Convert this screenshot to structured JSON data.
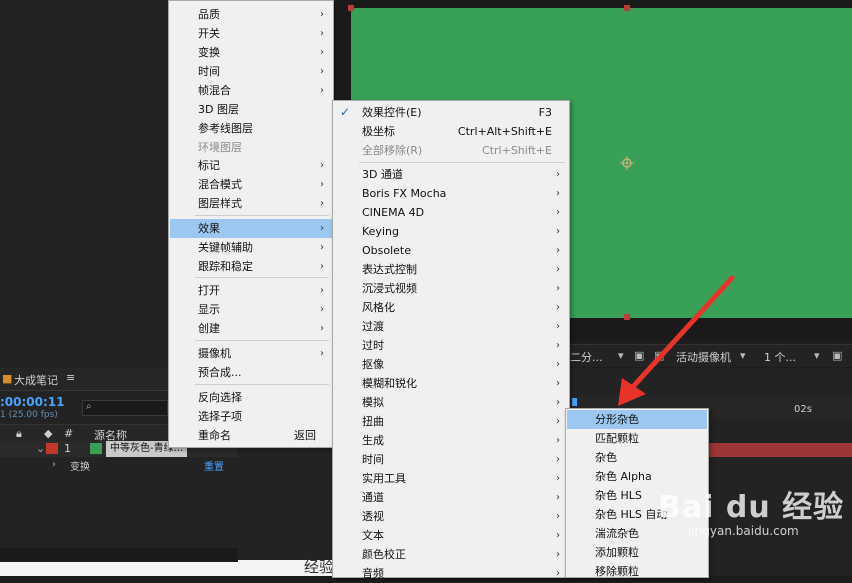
{
  "timeline": {
    "panel_tab": "大成笔记",
    "timecode": ":00:00:11",
    "fps_text": "1 (25.00 fps)",
    "col_label": "#",
    "col_source": "源名称",
    "layer_num": "1",
    "layer_name": "中等灰色-青绿...",
    "transform_label": "变换",
    "reset_label": "重置",
    "ruler_mark": "02s"
  },
  "viewer_toolbar": {
    "view_select": "二分...",
    "camera_select": "活动摄像机",
    "views_select": "1 个..."
  },
  "layer_menu": {
    "top_cut": "",
    "items": [
      {
        "label": "品质",
        "arrow": true
      },
      {
        "label": "开关",
        "arrow": true
      },
      {
        "label": "变换",
        "arrow": true
      },
      {
        "label": "时间",
        "arrow": true
      },
      {
        "label": "帧混合",
        "arrow": true
      },
      {
        "label": "3D 图层",
        "arrow": false
      },
      {
        "label": "参考线图层",
        "arrow": false
      },
      {
        "label": "环境图层",
        "arrow": false,
        "disabled": true
      },
      {
        "label": "标记",
        "arrow": true
      },
      {
        "label": "混合模式",
        "arrow": true
      },
      {
        "label": "图层样式",
        "arrow": true
      },
      {
        "label": "效果",
        "arrow": true,
        "highlight": true
      },
      {
        "label": "关键帧辅助",
        "arrow": true
      },
      {
        "label": "跟踪和稳定",
        "arrow": true
      },
      {
        "label": "打开",
        "arrow": true
      },
      {
        "label": "显示",
        "arrow": true
      },
      {
        "label": "创建",
        "arrow": true
      },
      {
        "label": "摄像机",
        "arrow": true
      },
      {
        "label": "预合成...",
        "arrow": false
      },
      {
        "label": "反向选择",
        "arrow": false
      },
      {
        "label": "选择子项",
        "arrow": false
      },
      {
        "label": "重命名",
        "shortcut": "返回",
        "arrow": false
      }
    ]
  },
  "effects_menu": {
    "items": [
      {
        "label": "效果控件(E)",
        "shortcut": "F3",
        "checked": true
      },
      {
        "label": "极坐标",
        "shortcut": "Ctrl+Alt+Shift+E"
      },
      {
        "label": "全部移除(R)",
        "shortcut": "Ctrl+Shift+E",
        "disabled": true
      },
      {
        "label": "3D 通道",
        "arrow": true
      },
      {
        "label": "Boris FX Mocha",
        "arrow": true
      },
      {
        "label": "CINEMA 4D",
        "arrow": true
      },
      {
        "label": "Keying",
        "arrow": true
      },
      {
        "label": "Obsolete",
        "arrow": true
      },
      {
        "label": "表达式控制",
        "arrow": true
      },
      {
        "label": "沉浸式视频",
        "arrow": true
      },
      {
        "label": "风格化",
        "arrow": true
      },
      {
        "label": "过渡",
        "arrow": true
      },
      {
        "label": "过时",
        "arrow": true
      },
      {
        "label": "抠像",
        "arrow": true
      },
      {
        "label": "模糊和锐化",
        "arrow": true
      },
      {
        "label": "模拟",
        "arrow": true
      },
      {
        "label": "扭曲",
        "arrow": true
      },
      {
        "label": "生成",
        "arrow": true
      },
      {
        "label": "时间",
        "arrow": true
      },
      {
        "label": "实用工具",
        "arrow": true
      },
      {
        "label": "通道",
        "arrow": true
      },
      {
        "label": "透视",
        "arrow": true
      },
      {
        "label": "文本",
        "arrow": true
      },
      {
        "label": "颜色校正",
        "arrow": true
      },
      {
        "label": "音频",
        "arrow": true
      }
    ]
  },
  "noise_menu": {
    "items": [
      {
        "label": "分形杂色",
        "highlight": true
      },
      {
        "label": "匹配颗粒"
      },
      {
        "label": "杂色"
      },
      {
        "label": "杂色 Alpha"
      },
      {
        "label": "杂色 HLS"
      },
      {
        "label": "杂色 HLS 自动"
      },
      {
        "label": "湍流杂色"
      },
      {
        "label": "添加颗粒"
      },
      {
        "label": "移除颗粒"
      }
    ]
  },
  "watermark": {
    "brand": "Bai du 经验",
    "url": "jingyan.baidu.com"
  },
  "bottom_text": "经验",
  "colors": {
    "green": "#38a057",
    "arrow": "#e8332a",
    "highlight": "#9bc7f0"
  }
}
